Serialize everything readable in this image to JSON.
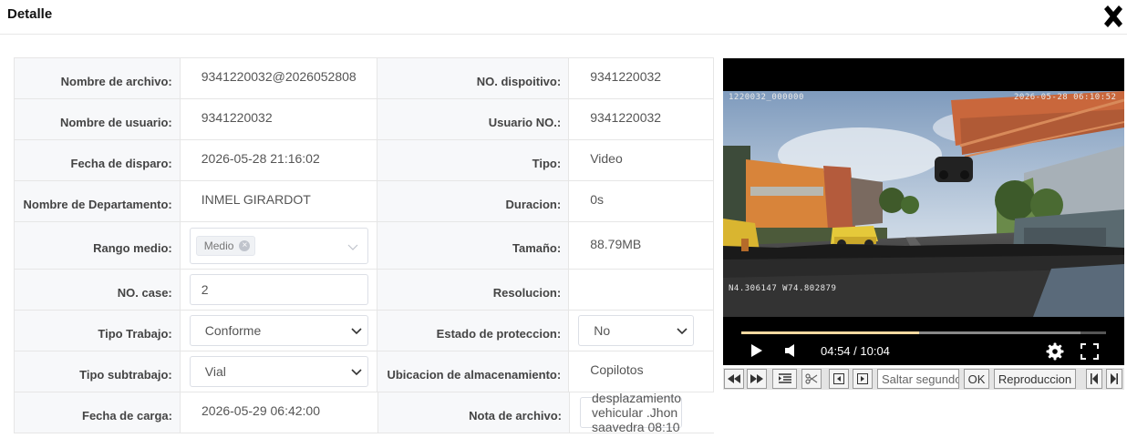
{
  "dialog": {
    "title": "Detalle"
  },
  "fields": {
    "file_name_label": "Nombre de archivo:",
    "file_name": "9341220032@2026052808",
    "device_no_label": "NO. dispoitivo:",
    "device_no": "9341220032",
    "user_name_label": "Nombre de usuario:",
    "user_name": "9341220032",
    "user_no_label": "Usuario NO.:",
    "user_no": "9341220032",
    "trigger_date_label": "Fecha de disparo:",
    "trigger_date": "2026-05-28 21:16:02",
    "type_label": "Tipo:",
    "type": "Video",
    "department_label": "Nombre de Departamento:",
    "department": "INMEL GIRARDOT",
    "duration_label": "Duracion:",
    "duration": "0s",
    "medium_range_label": "Rango medio:",
    "medium_range_tag": "Medio",
    "size_label": "Tamaño:",
    "size": "88.79MB",
    "case_no_label": "NO. case:",
    "case_no": "2",
    "resolution_label": "Resolucion:",
    "resolution": "",
    "work_type_label": "Tipo Trabajo:",
    "work_type": "Conforme",
    "protection_label": "Estado de proteccion:",
    "protection": "No",
    "work_subtype_label": "Tipo subtrabajo:",
    "work_subtype": "Vial",
    "storage_label": "Ubicacion de almacenamiento:",
    "storage": "Copilotos",
    "upload_date_label": "Fecha de carga:",
    "upload_date": "2026-05-29 06:42:00",
    "note_label": "Nota de archivo:",
    "note": "desplazamiento vehicular .Jhon saavedra 08:10"
  },
  "player": {
    "overlay_id": "1220032_000000",
    "overlay_timestamp": "2026-05-28 06:10:52",
    "overlay_gps": "N4.306147 W74.802879",
    "time_display": "04:54 / 10:04",
    "progress": 0.487,
    "buffered": 0.93
  },
  "toolbar": {
    "seek_placeholder": "Saltar segundos",
    "ok_label": "OK",
    "playback_label": "Reproduccion"
  },
  "icons": {
    "close": "close-icon",
    "play": "play-icon",
    "volume": "volume-icon",
    "settings": "gear-icon",
    "fullscreen": "fullscreen-icon"
  }
}
